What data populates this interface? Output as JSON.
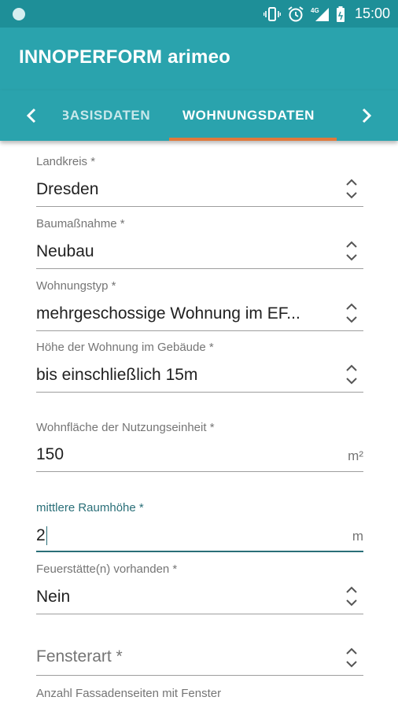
{
  "statusbar": {
    "time": "15:00",
    "network": "4G"
  },
  "appbar": {
    "title": "INNOPERFORM arimeo"
  },
  "tabs": [
    {
      "label": "BASISDATEN",
      "selected": false
    },
    {
      "label": "WOHNUNGSDATEN",
      "selected": true
    }
  ],
  "form": {
    "landkreis": {
      "label": "Landkreis *",
      "value": "Dresden"
    },
    "baumassnahme": {
      "label": "Baumaßnahme *",
      "value": "Neubau"
    },
    "wohnungstyp": {
      "label": "Wohnungstyp *",
      "value": "mehrgeschossige Wohnung im EF..."
    },
    "hoehe": {
      "label": "Höhe der Wohnung im Gebäude *",
      "value": "bis einschließlich 15m"
    },
    "wohnflaeche": {
      "label": "Wohnfläche der Nutzungseinheit *",
      "value": "150",
      "unit": "m²"
    },
    "raumhoehe": {
      "label": "mittlere Raumhöhe *",
      "value": "2",
      "unit": "m"
    },
    "feuerstaette": {
      "label": "Feuerstätte(n) vorhanden *",
      "value": "Nein"
    },
    "fensterart": {
      "placeholder": "Fensterart *"
    },
    "fassadenseiten": {
      "label": "Anzahl Fassadenseiten mit Fenster"
    }
  },
  "colors": {
    "statusbar": "#1e8f98",
    "primary": "#2aa3ad",
    "tab_indicator": "#e0793b",
    "focus": "#2a6f78"
  },
  "icons": [
    "app-notification-icon",
    "vibrate-icon",
    "alarm-icon",
    "signal-icon",
    "battery-icon",
    "chevron-left-icon",
    "chevron-right-icon",
    "spinner-arrows-icon"
  ]
}
